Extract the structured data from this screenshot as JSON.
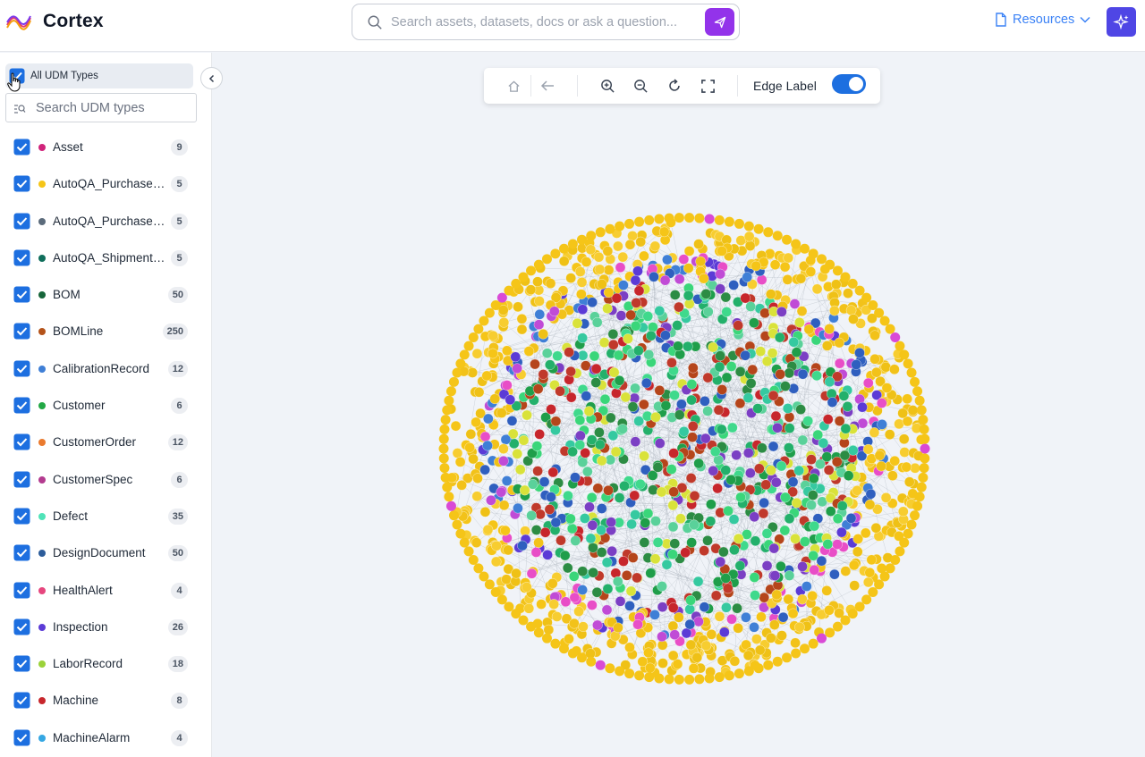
{
  "header": {
    "brand": "Cortex",
    "search_placeholder": "Search assets, datasets, docs or ask a question...",
    "resources_label": "Resources"
  },
  "sidebar": {
    "all_label": "All UDM Types",
    "search_placeholder": "Search UDM types",
    "items": [
      {
        "name": "Asset",
        "count": "9",
        "color": "#d0237a"
      },
      {
        "name": "AutoQA_PurchaseOrder",
        "count": "5",
        "color": "#f5c518"
      },
      {
        "name": "AutoQA_PurchaseOrderLine",
        "count": "5",
        "color": "#5b6b7b"
      },
      {
        "name": "AutoQA_ShipmentRecord",
        "count": "5",
        "color": "#0f6e5b"
      },
      {
        "name": "BOM",
        "count": "50",
        "color": "#16653a"
      },
      {
        "name": "BOMLine",
        "count": "250",
        "color": "#b4531a"
      },
      {
        "name": "CalibrationRecord",
        "count": "12",
        "color": "#3f7fd6"
      },
      {
        "name": "Customer",
        "count": "6",
        "color": "#22a845"
      },
      {
        "name": "CustomerOrder",
        "count": "12",
        "color": "#ea7a2e"
      },
      {
        "name": "CustomerSpec",
        "count": "6",
        "color": "#b33b8f"
      },
      {
        "name": "Defect",
        "count": "35",
        "color": "#4fe3b8"
      },
      {
        "name": "DesignDocument",
        "count": "50",
        "color": "#2c5c9a"
      },
      {
        "name": "HealthAlert",
        "count": "4",
        "color": "#e6467e"
      },
      {
        "name": "Inspection",
        "count": "26",
        "color": "#5b3bd6"
      },
      {
        "name": "LaborRecord",
        "count": "18",
        "color": "#9bd23a"
      },
      {
        "name": "Machine",
        "count": "8",
        "color": "#c7262c"
      },
      {
        "name": "MachineAlarm",
        "count": "4",
        "color": "#35a7e3"
      }
    ]
  },
  "toolbar": {
    "edge_label": "Edge Label",
    "edge_label_on": true
  },
  "colors": {
    "accent": "#9333ea",
    "link": "#3b82f6",
    "checkbox": "#1d6fe0"
  }
}
